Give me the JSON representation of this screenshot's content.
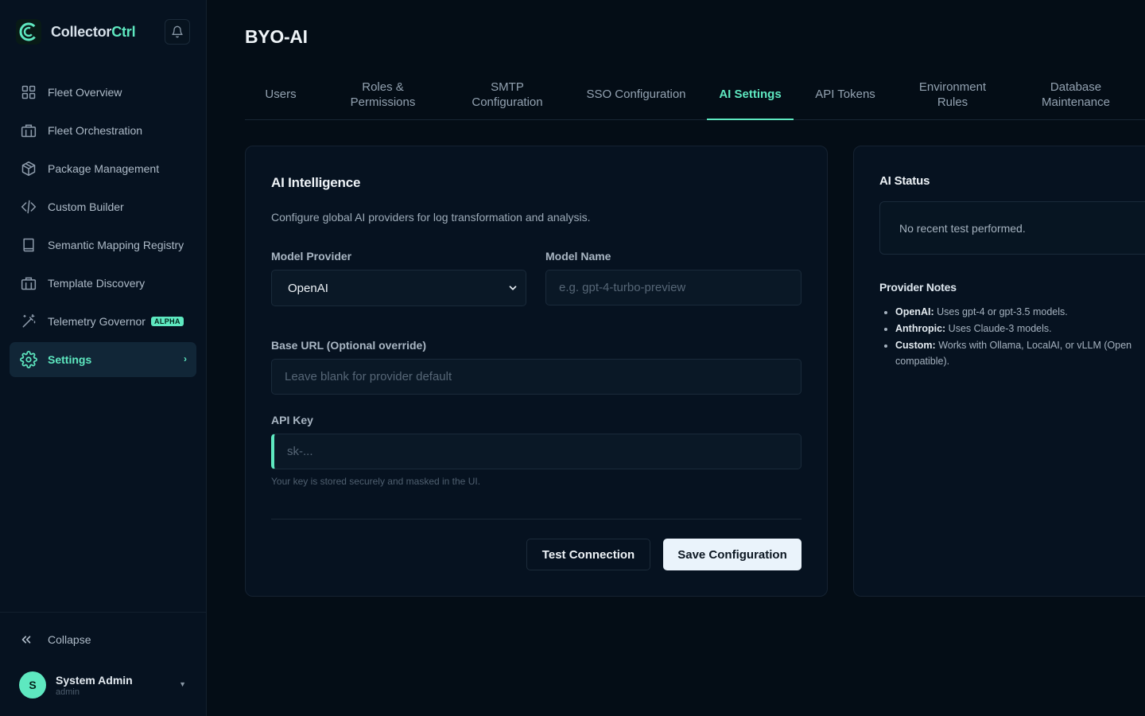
{
  "brand": {
    "name_part1": "Collector",
    "name_part2": "Ctrl"
  },
  "sidebar": {
    "items": [
      {
        "label": "Fleet Overview",
        "icon": "grid-icon"
      },
      {
        "label": "Fleet Orchestration",
        "icon": "building-icon"
      },
      {
        "label": "Package Management",
        "icon": "package-icon"
      },
      {
        "label": "Custom Builder",
        "icon": "code-icon"
      },
      {
        "label": "Semantic Mapping Registry",
        "icon": "book-icon"
      },
      {
        "label": "Template Discovery",
        "icon": "building-icon"
      },
      {
        "label": "Telemetry Governor",
        "icon": "wand-icon",
        "badge": "ALPHA"
      },
      {
        "label": "Settings",
        "icon": "gear-icon",
        "active": true
      }
    ],
    "collapse_label": "Collapse",
    "user": {
      "initial": "S",
      "name": "System Admin",
      "role": "admin"
    }
  },
  "page": {
    "title": "BYO-AI"
  },
  "tabs": [
    {
      "label": "Users"
    },
    {
      "label": "Roles & Permissions"
    },
    {
      "label": "SMTP Configuration"
    },
    {
      "label": "SSO Configuration"
    },
    {
      "label": "AI Settings",
      "active": true
    },
    {
      "label": "API Tokens"
    },
    {
      "label": "Environment Rules"
    },
    {
      "label": "Database Maintenance"
    }
  ],
  "ai_card": {
    "title": "AI Intelligence",
    "description": "Configure global AI providers for log transformation and analysis.",
    "provider_label": "Model Provider",
    "provider_value": "OpenAI",
    "model_label": "Model Name",
    "model_placeholder": "e.g. gpt-4-turbo-preview",
    "base_url_label": "Base URL (Optional override)",
    "base_url_placeholder": "Leave blank for provider default",
    "api_key_label": "API Key",
    "api_key_placeholder": "sk-...",
    "api_key_hint": "Your key is stored securely and masked in the UI.",
    "test_button": "Test Connection",
    "save_button": "Save Configuration"
  },
  "status_card": {
    "title": "AI Status",
    "status_text": "No recent test performed.",
    "notes_title": "Provider Notes",
    "notes": [
      {
        "name": "OpenAI:",
        "text": "Uses gpt-4 or gpt-3.5 models."
      },
      {
        "name": "Anthropic:",
        "text": "Uses Claude-3 models."
      },
      {
        "name": "Custom:",
        "text": "Works with Ollama, LocalAI, or vLLM (Open compatible)."
      }
    ]
  },
  "colors": {
    "accent": "#5ee8c0",
    "background": "#040d16",
    "panel": "#061220"
  }
}
